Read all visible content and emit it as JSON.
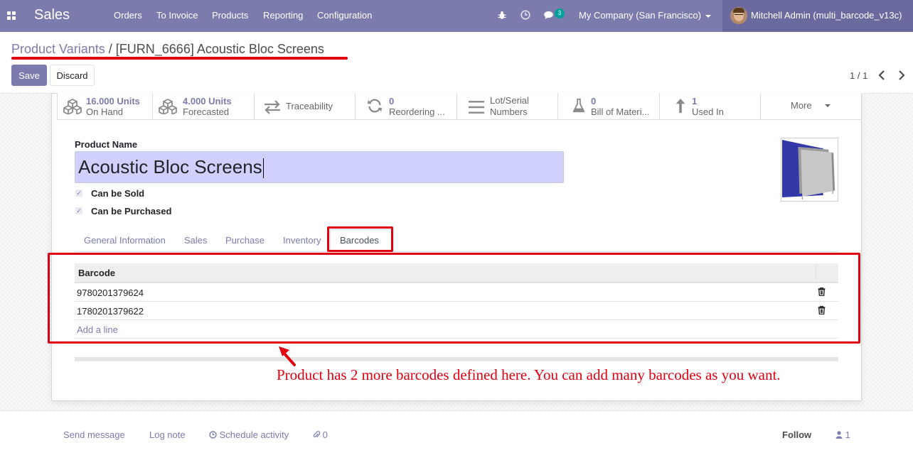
{
  "navbar": {
    "app_name": "Sales",
    "menu": [
      "Orders",
      "To Invoice",
      "Products",
      "Reporting",
      "Configuration"
    ],
    "chat_count": "3",
    "company": "My Company (San Francisco)",
    "user": "Mitchell Admin (multi_barcode_v13c)",
    "icons": [
      "apps-grid-icon",
      "bug-icon",
      "clock-icon",
      "chat-icon"
    ]
  },
  "breadcrumb": {
    "parent": "Product Variants",
    "separator": "/",
    "current": "[FURN_6666] Acoustic Bloc Screens"
  },
  "actions": {
    "save": "Save",
    "discard": "Discard"
  },
  "pager": {
    "value": "1 / 1"
  },
  "smart_buttons": [
    {
      "value": "16.000 Units",
      "label": "On Hand",
      "icon": "cubes-icon"
    },
    {
      "value": "4.000 Units",
      "label": "Forecasted",
      "icon": "cubes-icon"
    },
    {
      "value": "",
      "label": "Traceability",
      "icon": "exchange-arrows-icon"
    },
    {
      "value": "0",
      "label": "Reordering ...",
      "icon": "refresh-icon"
    },
    {
      "value": "Lot/Serial",
      "label": "Numbers",
      "icon": "list-icon"
    },
    {
      "value": "0",
      "label": "Bill of Materi...",
      "icon": "flask-icon"
    },
    {
      "value": "1",
      "label": "Used In",
      "icon": "level-up-icon"
    },
    {
      "value": "",
      "label": "More",
      "icon": "caret-down-icon"
    }
  ],
  "form": {
    "name_label": "Product Name",
    "name_value": "Acoustic Bloc Screens",
    "can_be_sold": "Can be Sold",
    "can_be_purchased": "Can be Purchased"
  },
  "tabs": [
    "General Information",
    "Sales",
    "Purchase",
    "Inventory",
    "Barcodes"
  ],
  "active_tab": "Barcodes",
  "barcodes": {
    "header": "Barcode",
    "rows": [
      "9780201379624",
      "1780201379622"
    ],
    "add_line": "Add a line"
  },
  "annotation": "Product has 2 more barcodes defined here. You can add many barcodes as you want.",
  "chatter": {
    "send_message": "Send message",
    "log_note": "Log note",
    "schedule_activity": "Schedule activity",
    "attachments": "0",
    "follow": "Follow",
    "followers": "1"
  },
  "colors": {
    "brand": "#7c7bad",
    "highlight": "#e0000f",
    "input_bg": "#d0d0fc"
  }
}
